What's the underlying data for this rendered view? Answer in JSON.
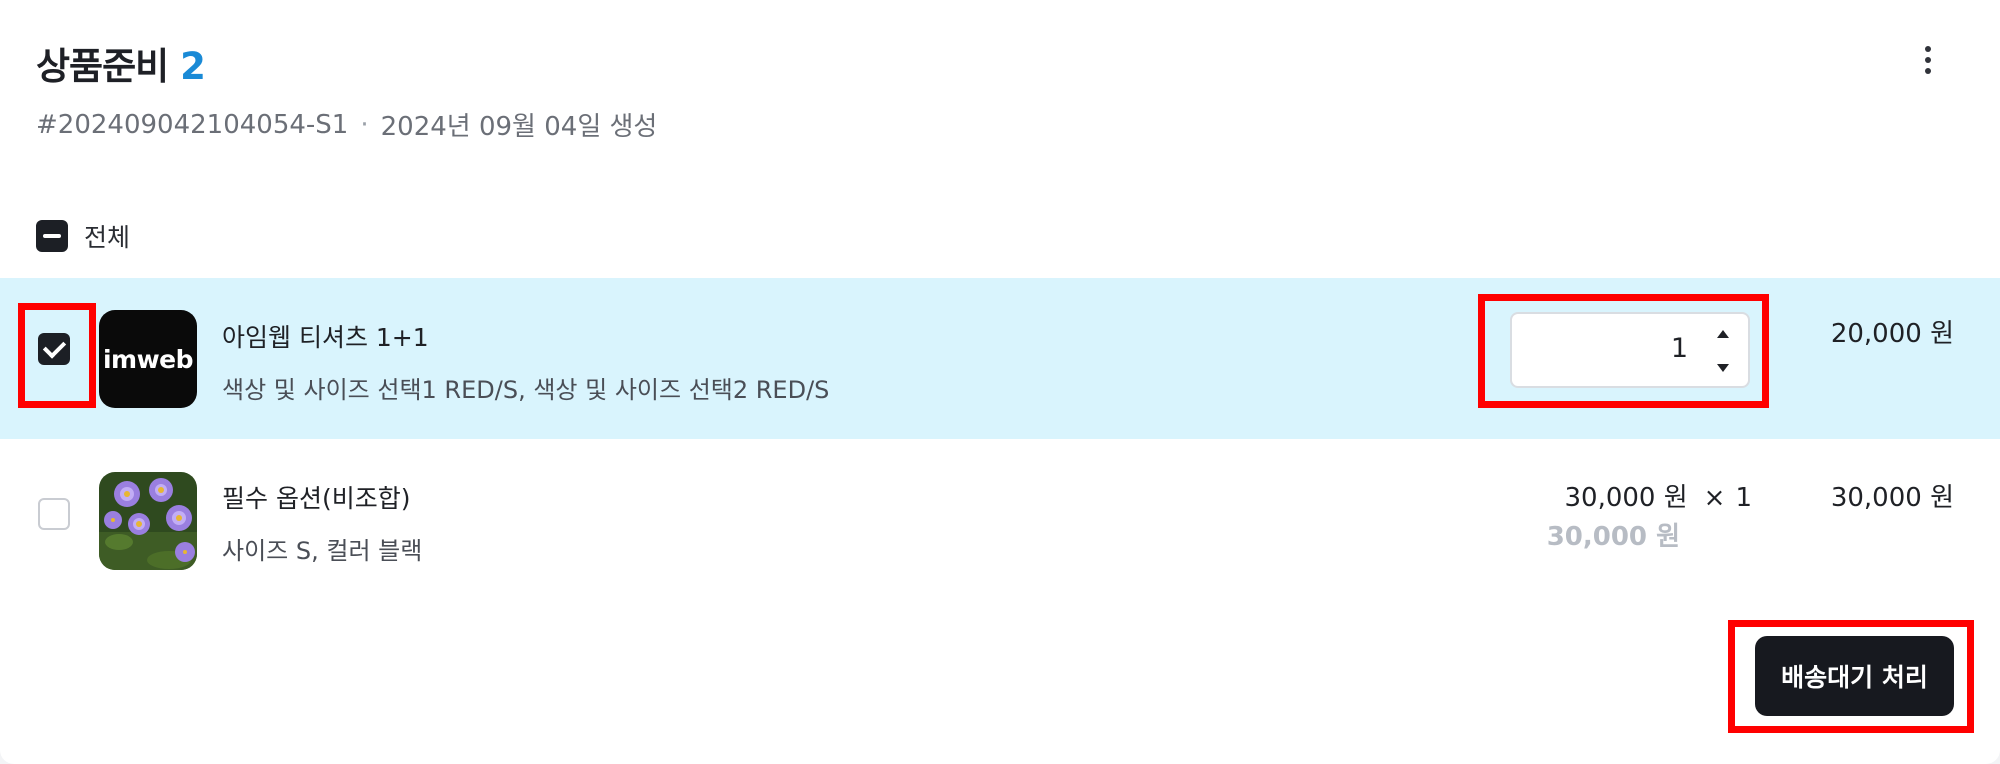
{
  "header": {
    "title": "상품준비",
    "count": "2",
    "more_icon": "kebab-vertical-icon",
    "order_no": "#202409042104054-S1",
    "separator": "·",
    "created": "2024년 09월 04일 생성"
  },
  "select_all": {
    "label": "전체",
    "state": "indeterminate"
  },
  "items": [
    {
      "selected": true,
      "thumb_text": "imweb",
      "name": "아임웹 티셔츠 1+1",
      "options": "색상 및 사이즈 선택1 RED/S, 색상 및 사이즈 선택2 RED/S",
      "quantity": "1",
      "total": "20,000 원"
    },
    {
      "selected": false,
      "thumb_image": "purple-flowers-photo",
      "name": "필수 옵션(비조합)",
      "options": "사이즈 S, 컬러 블랙",
      "unit_price": "30,000 원",
      "times": "×",
      "quantity": "1",
      "unit_price_sub": "30,000 원",
      "total": "30,000 원"
    }
  ],
  "action": {
    "label": "배송대기 처리"
  },
  "colors": {
    "accent_count": "#1a8ad6",
    "selected_row_bg": "#d9f4fd",
    "button_bg": "#17191f",
    "highlight": "#ff0000"
  }
}
